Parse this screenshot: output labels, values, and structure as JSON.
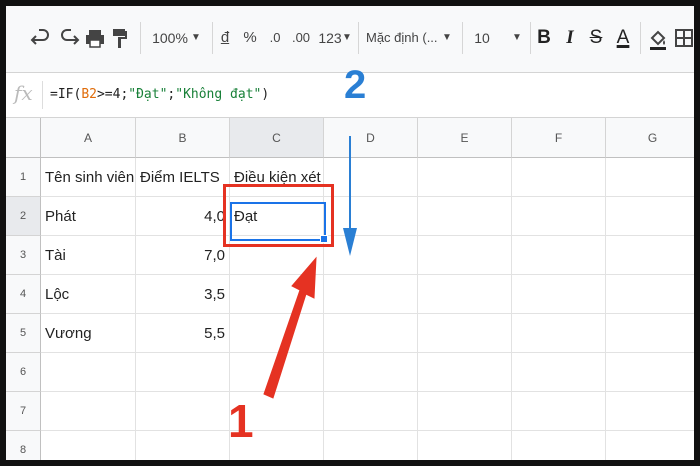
{
  "toolbar": {
    "zoom": "100%",
    "currency": "đ",
    "percent": "%",
    "dec_decrease": ".0",
    "dec_increase": ".00",
    "number_format": "123",
    "font_name": "Mặc định (...",
    "font_size": "10",
    "bold": "B",
    "italic": "I",
    "strike": "S",
    "text_color": "A"
  },
  "formula_bar": {
    "fx": "fx",
    "formula_prefix": "=IF(",
    "formula_ref": "B2",
    "formula_mid": ">=4;",
    "formula_str1": "\"Đạt\"",
    "formula_sep": ";",
    "formula_str2": "\"Không đạt\"",
    "formula_end": ")"
  },
  "columns": [
    "A",
    "B",
    "C",
    "D",
    "E",
    "F",
    "G"
  ],
  "rows": [
    "1",
    "2",
    "3",
    "4",
    "5",
    "6",
    "7",
    "8"
  ],
  "cells": {
    "a1": "Tên sinh viên",
    "b1": "Điểm IELTS",
    "c1": "Điều kiện xét",
    "a2": "Phát",
    "b2": "4,0",
    "c2": "Đạt",
    "a3": "Tài",
    "b3": "7,0",
    "a4": "Lộc",
    "b4": "3,5",
    "a5": "Vương",
    "b5": "5,5"
  },
  "annotations": {
    "step1": "1",
    "step2": "2",
    "red": "#e53222",
    "blue": "#2a7fd4"
  }
}
